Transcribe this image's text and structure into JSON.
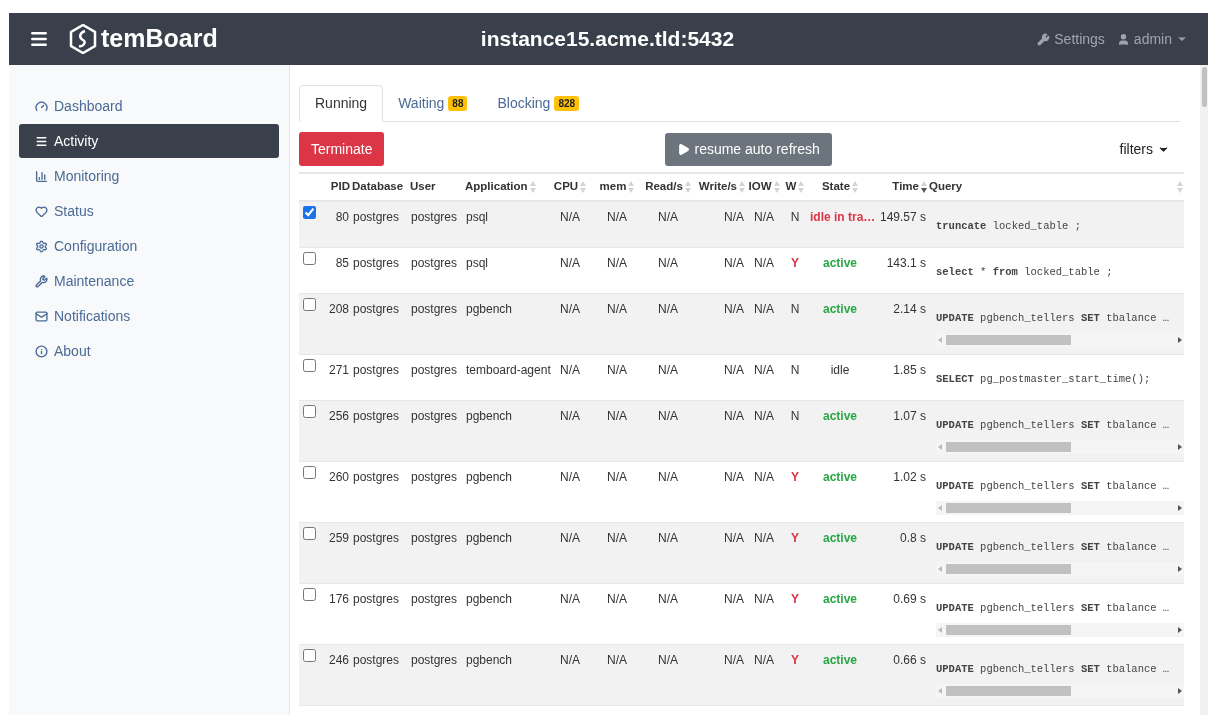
{
  "navbar": {
    "brand": "temBoard",
    "instance": "instance15.acme.tld:5432",
    "settings": "Settings",
    "user": "admin"
  },
  "sidebar": {
    "items": [
      {
        "label": "Dashboard",
        "selected": false
      },
      {
        "label": "Activity",
        "selected": true
      },
      {
        "label": "Monitoring",
        "selected": false
      },
      {
        "label": "Status",
        "selected": false
      },
      {
        "label": "Configuration",
        "selected": false
      },
      {
        "label": "Maintenance",
        "selected": false
      },
      {
        "label": "Notifications",
        "selected": false
      },
      {
        "label": "About",
        "selected": false
      }
    ]
  },
  "tabs": [
    {
      "label": "Running",
      "selected": true
    },
    {
      "label": "Waiting",
      "badge": "88",
      "selected": false
    },
    {
      "label": "Blocking",
      "badge": "828",
      "selected": false
    }
  ],
  "toolbar": {
    "terminate": "Terminate",
    "resume": "resume auto refresh",
    "filters": "filters"
  },
  "table": {
    "columns": [
      {
        "label": "PID"
      },
      {
        "label": "Database"
      },
      {
        "label": "User"
      },
      {
        "label": "Application",
        "sortable": true,
        "sorted": false
      },
      {
        "label": "CPU",
        "sortable": true,
        "sorted": false
      },
      {
        "label": "mem",
        "sortable": true,
        "sorted": false
      },
      {
        "label": "Read/s",
        "sortable": true,
        "sorted": false
      },
      {
        "label": "Write/s",
        "sortable": true,
        "sorted": false
      },
      {
        "label": "IOW",
        "sortable": true,
        "sorted": false
      },
      {
        "label": "W",
        "sortable": true,
        "sorted": false
      },
      {
        "label": "State",
        "sortable": true,
        "sorted": false
      },
      {
        "label": "Time",
        "sortable": true,
        "sorted": true
      },
      {
        "label": "Query",
        "sortable": true,
        "sorted": false
      }
    ],
    "rows": [
      {
        "checked": true,
        "pid": "80",
        "database": "postgres",
        "user": "postgres",
        "application": "psql",
        "cpu": "N/A",
        "mem": "N/A",
        "read": "N/A",
        "write": "N/A",
        "iow": "N/A",
        "w": {
          "text": "N",
          "alert": false
        },
        "state": {
          "text": "idle in tra…",
          "kind": "idle_tx"
        },
        "time": "149.57 s",
        "query": "**truncate** locked_table ;",
        "scrollable": false
      },
      {
        "checked": false,
        "pid": "85",
        "database": "postgres",
        "user": "postgres",
        "application": "psql",
        "cpu": "N/A",
        "mem": "N/A",
        "read": "N/A",
        "write": "N/A",
        "iow": "N/A",
        "w": {
          "text": "Y",
          "alert": true
        },
        "state": {
          "text": "active",
          "kind": "active"
        },
        "time": "143.1 s",
        "query": "**select** * **from** locked_table ;",
        "scrollable": false
      },
      {
        "checked": false,
        "pid": "208",
        "database": "postgres",
        "user": "postgres",
        "application": "pgbench",
        "cpu": "N/A",
        "mem": "N/A",
        "read": "N/A",
        "write": "N/A",
        "iow": "N/A",
        "w": {
          "text": "N",
          "alert": false
        },
        "state": {
          "text": "active",
          "kind": "active"
        },
        "time": "2.14 s",
        "query": "**UPDATE** pgbench_tellers **SET** tbalance …",
        "scrollable": true
      },
      {
        "checked": false,
        "pid": "271",
        "database": "postgres",
        "user": "postgres",
        "application": "temboard-agent",
        "cpu": "N/A",
        "mem": "N/A",
        "read": "N/A",
        "write": "N/A",
        "iow": "N/A",
        "w": {
          "text": "N",
          "alert": false
        },
        "state": {
          "text": "idle",
          "kind": "idle"
        },
        "time": "1.85 s",
        "query": "**SELECT** pg_postmaster_start_time();",
        "scrollable": false
      },
      {
        "checked": false,
        "pid": "256",
        "database": "postgres",
        "user": "postgres",
        "application": "pgbench",
        "cpu": "N/A",
        "mem": "N/A",
        "read": "N/A",
        "write": "N/A",
        "iow": "N/A",
        "w": {
          "text": "N",
          "alert": false
        },
        "state": {
          "text": "active",
          "kind": "active"
        },
        "time": "1.07 s",
        "query": "**UPDATE** pgbench_tellers **SET** tbalance …",
        "scrollable": true
      },
      {
        "checked": false,
        "pid": "260",
        "database": "postgres",
        "user": "postgres",
        "application": "pgbench",
        "cpu": "N/A",
        "mem": "N/A",
        "read": "N/A",
        "write": "N/A",
        "iow": "N/A",
        "w": {
          "text": "Y",
          "alert": true
        },
        "state": {
          "text": "active",
          "kind": "active"
        },
        "time": "1.02 s",
        "query": "**UPDATE** pgbench_tellers **SET** tbalance …",
        "scrollable": true
      },
      {
        "checked": false,
        "pid": "259",
        "database": "postgres",
        "user": "postgres",
        "application": "pgbench",
        "cpu": "N/A",
        "mem": "N/A",
        "read": "N/A",
        "write": "N/A",
        "iow": "N/A",
        "w": {
          "text": "Y",
          "alert": true
        },
        "state": {
          "text": "active",
          "kind": "active"
        },
        "time": "0.8 s",
        "query": "**UPDATE** pgbench_tellers **SET** tbalance …",
        "scrollable": true
      },
      {
        "checked": false,
        "pid": "176",
        "database": "postgres",
        "user": "postgres",
        "application": "pgbench",
        "cpu": "N/A",
        "mem": "N/A",
        "read": "N/A",
        "write": "N/A",
        "iow": "N/A",
        "w": {
          "text": "Y",
          "alert": true
        },
        "state": {
          "text": "active",
          "kind": "active"
        },
        "time": "0.69 s",
        "query": "**UPDATE** pgbench_tellers **SET** tbalance …",
        "scrollable": true
      },
      {
        "checked": false,
        "pid": "246",
        "database": "postgres",
        "user": "postgres",
        "application": "pgbench",
        "cpu": "N/A",
        "mem": "N/A",
        "read": "N/A",
        "write": "N/A",
        "iow": "N/A",
        "w": {
          "text": "Y",
          "alert": true
        },
        "state": {
          "text": "active",
          "kind": "active"
        },
        "time": "0.66 s",
        "query": "**UPDATE** pgbench_tellers **SET** tbalance …",
        "scrollable": true
      }
    ]
  }
}
